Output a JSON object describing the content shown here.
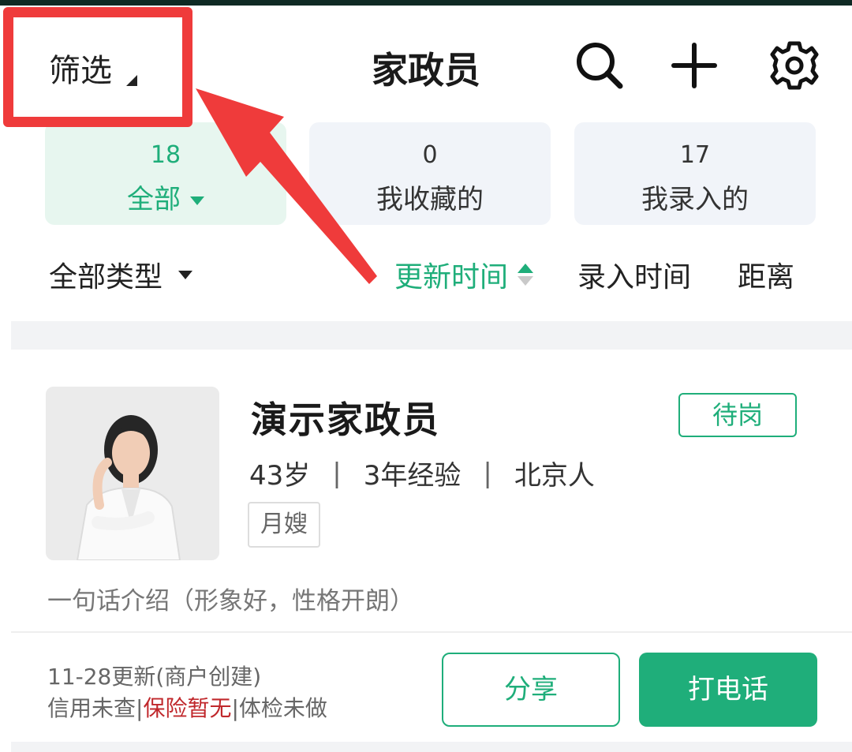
{
  "header": {
    "filter_label": "筛选",
    "title": "家政员",
    "icons": [
      "search-icon",
      "add-icon",
      "gear-icon"
    ]
  },
  "stats": [
    {
      "count": "18",
      "label": "全部",
      "active": true
    },
    {
      "count": "0",
      "label": "我收藏的",
      "active": false
    },
    {
      "count": "17",
      "label": "我录入的",
      "active": false
    }
  ],
  "sort": {
    "type_filter": "全部类型",
    "update_time": "更新时间",
    "entry_time": "录入时间",
    "distance": "距离"
  },
  "worker": {
    "name": "演示家政员",
    "status": "待岗",
    "age": "43岁",
    "experience": "3年经验",
    "origin": "北京人",
    "tag": "月嫂",
    "intro": "一句话介绍（形象好，性格开朗）",
    "update_info": "11-28更新(商户创建)",
    "credit": "信用未查",
    "insurance": "保险暂无",
    "health": "体检未做",
    "separator": "|",
    "share_label": "分享",
    "call_label": "打电话"
  },
  "colors": {
    "accent": "#1fae7a",
    "highlight": "#ef3b3b",
    "warning": "#c0282c"
  }
}
